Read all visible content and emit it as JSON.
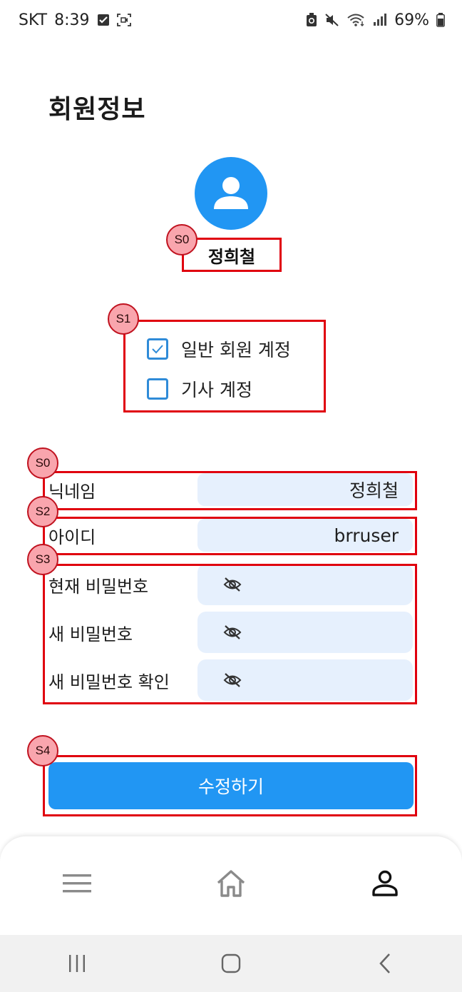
{
  "status_bar": {
    "carrier": "SKT",
    "time": "8:39",
    "battery": "69%"
  },
  "page": {
    "title": "회원정보"
  },
  "profile": {
    "name": "정희철",
    "avatar_icon": "person-icon"
  },
  "accounts": [
    {
      "label": "일반 회원 계정",
      "checked": true
    },
    {
      "label": "기사 계정",
      "checked": false
    }
  ],
  "fields": {
    "nickname": {
      "label": "닉네임",
      "value": "정희철"
    },
    "user_id": {
      "label": "아이디",
      "value": "brruser"
    }
  },
  "passwords": [
    {
      "label": "현재 비밀번호",
      "icon": "eye-off-icon"
    },
    {
      "label": "새 비밀번호",
      "icon": "eye-off-icon"
    },
    {
      "label": "새 비밀번호 확인",
      "icon": "eye-off-icon"
    }
  ],
  "submit_label": "수정하기",
  "annotations": [
    "S0",
    "S1",
    "S0",
    "S2",
    "S3",
    "S4"
  ],
  "bottom_nav": [
    "menu-icon",
    "home-icon",
    "profile-icon"
  ],
  "colors": {
    "accent": "#2196f3",
    "field_bg": "#e6f0fd",
    "annotation": "#e0000e"
  }
}
